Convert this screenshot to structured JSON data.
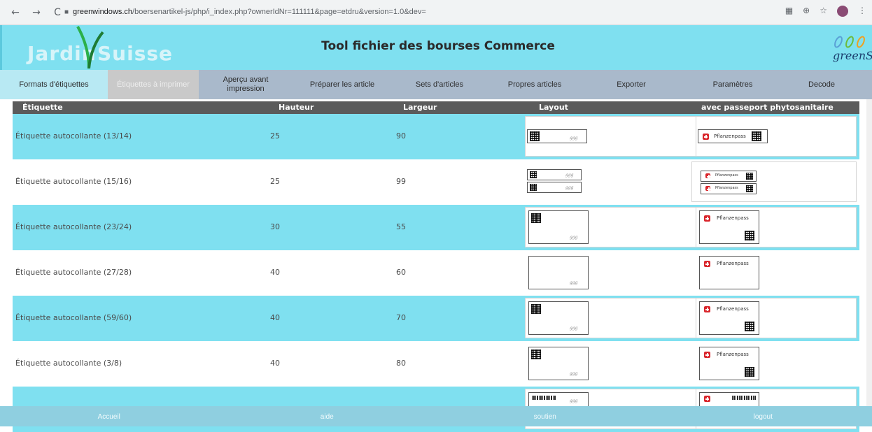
{
  "browser": {
    "url_host": "greenwindows.ch",
    "url_path": "/boersenartikel-js/php/i_index.php?ownerIdNr=111111&page=etdru&version=1.0&dev="
  },
  "header": {
    "logo_word1": "Jardin",
    "logo_word2": "Suisse",
    "title": "Tool fichier des bourses Commerce",
    "brand": "greenSys"
  },
  "tabs": [
    {
      "label": "Formats d'étiquettes",
      "state": "active"
    },
    {
      "label": "Étiquettes à imprimer",
      "state": "disabled"
    },
    {
      "label": "Aperçu avant impression",
      "state": "normal"
    },
    {
      "label": "Préparer les article",
      "state": "normal"
    },
    {
      "label": "Sets d'articles",
      "state": "normal"
    },
    {
      "label": "Propres articles",
      "state": "normal"
    },
    {
      "label": "Exporter",
      "state": "normal"
    },
    {
      "label": "Paramètres",
      "state": "normal"
    },
    {
      "label": "Decode",
      "state": "normal"
    }
  ],
  "table": {
    "headers": {
      "etiquette": "Étiquette",
      "hauteur": "Hauteur",
      "largeur": "Largeur",
      "layout": "Layout",
      "passeport": "avec passeport phytosanitaire"
    },
    "rows": [
      {
        "name": "Étiquette autocollante (13/14)",
        "hauteur": "25",
        "largeur": "90"
      },
      {
        "name": "Étiquette autocollante (15/16)",
        "hauteur": "25",
        "largeur": "99"
      },
      {
        "name": "Étiquette autocollante (23/24)",
        "hauteur": "30",
        "largeur": "55"
      },
      {
        "name": "Étiquette autocollante (27/28)",
        "hauteur": "40",
        "largeur": "60"
      },
      {
        "name": "Étiquette autocollante (59/60)",
        "hauteur": "40",
        "largeur": "70"
      },
      {
        "name": "Étiquette autocollante (3/8)",
        "hauteur": "40",
        "largeur": "80"
      },
      {
        "name": "",
        "hauteur": "",
        "largeur": ""
      }
    ],
    "pflanzenpass_label": "Pflanzenpass"
  },
  "footer": {
    "accueil": "Accueil",
    "aide": "aide",
    "soutien": "soutien",
    "logout": "logout"
  },
  "colors": {
    "accent_cyan": "#7fe0f0",
    "tabbar": "#a9b9cb",
    "table_header": "#5b5b5b"
  }
}
